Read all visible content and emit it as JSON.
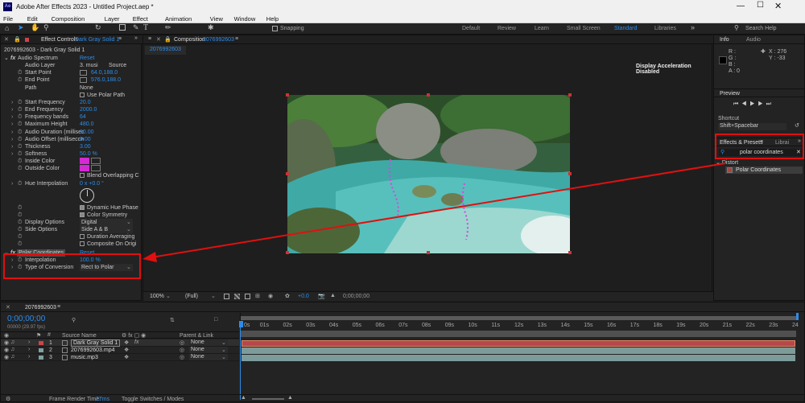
{
  "window": {
    "title": "Adobe After Effects 2023 - Untitled Project.aep *",
    "app_icon": "Ae"
  },
  "menu": [
    "File",
    "Edit",
    "Composition",
    "Layer",
    "Effect",
    "Animation",
    "View",
    "Window",
    "Help"
  ],
  "toolbar": {
    "snapping": "Snapping",
    "workspaces": [
      "Default",
      "Review",
      "Learn",
      "Small Screen",
      "Standard",
      "Libraries"
    ],
    "active_workspace": "Standard",
    "search_placeholder": "Search Help"
  },
  "effect_controls": {
    "tab_label": "Effect Controls",
    "layer_name": "Dark Gray Solid 1",
    "comp_layer": "2076992603 - Dark Gray Solid 1",
    "effects": [
      {
        "name": "Audio Spectrum",
        "reset": "Reset"
      },
      {
        "name": "Polar Coordinates",
        "reset": "Reset"
      }
    ],
    "audio_spectrum_props": [
      {
        "label": "Audio Layer",
        "value": "3. musi",
        "value2": "Source"
      },
      {
        "label": "Start Point",
        "value": "64.0,188.0"
      },
      {
        "label": "End Point",
        "value": "576.0,188.0"
      },
      {
        "label": "Path",
        "value": "None"
      },
      {
        "label": "",
        "value": "Use Polar Path"
      },
      {
        "label": "Start Frequency",
        "value": "20.0"
      },
      {
        "label": "End Frequency",
        "value": "2000.0"
      },
      {
        "label": "Frequency bands",
        "value": "64"
      },
      {
        "label": "Maximum Height",
        "value": "480.0"
      },
      {
        "label": "Audio Duration (millisec",
        "value": "90.00"
      },
      {
        "label": "Audio Offset (millisecon",
        "value": "0.00"
      },
      {
        "label": "Thickness",
        "value": "3.00"
      },
      {
        "label": "Softness",
        "value": "50.0 %"
      },
      {
        "label": "Inside Color",
        "value": ""
      },
      {
        "label": "Outside Color",
        "value": ""
      },
      {
        "label": "",
        "value": "Blend Overlapping C"
      },
      {
        "label": "Hue Interpolation",
        "value": "0 x +0.0 °"
      }
    ],
    "audio_spectrum_props2": [
      {
        "label": "",
        "value": "Dynamic Hue Phase"
      },
      {
        "label": "",
        "value": "Color Symmetry"
      },
      {
        "label": "Display Options",
        "value": "Digital"
      },
      {
        "label": "Side Options",
        "value": "Side A & B"
      },
      {
        "label": "",
        "value": "Duration Averaging"
      },
      {
        "label": "",
        "value": "Composite On Origi"
      }
    ],
    "polar_props": [
      {
        "label": "Interpolation",
        "value": "100.0 %"
      },
      {
        "label": "Type of Conversion",
        "value": "Rect to Polar"
      }
    ]
  },
  "composition": {
    "tab_label": "Composition",
    "comp_name": "2076992603",
    "breadcrumb": "2076992603",
    "notice": "Display Acceleration Disabled",
    "zoom": "100%",
    "resolution": "(Full)",
    "exposure": "+0.0",
    "timecode": "0;00;00;00"
  },
  "info": {
    "tabs": [
      "Info",
      "Audio"
    ],
    "r": "R :",
    "g": "G :",
    "b": "B :",
    "a": "A :",
    "a_val": "0",
    "x": "X : 276",
    "y": "Y : -33"
  },
  "preview": {
    "title": "Preview",
    "shortcut_label": "Shortcut",
    "shortcut_value": "Shift+Spacebar"
  },
  "effects_presets": {
    "tabs": [
      "Effects & Presets",
      "Librai"
    ],
    "search_value": "polar coordinates",
    "category": "Distort",
    "result": "Polar Coordinates"
  },
  "timeline": {
    "comp_tab": "2076992603",
    "timecode": "0;00;00;00",
    "fps": "00000 (29.97 fps)",
    "col_source": "Source Name",
    "col_parent": "Parent & Link",
    "ticks": [
      "0s",
      "01s",
      "02s",
      "03s",
      "04s",
      "05s",
      "06s",
      "07s",
      "08s",
      "09s",
      "10s",
      "11s",
      "12s",
      "13s",
      "14s",
      "15s",
      "16s",
      "17s",
      "18s",
      "19s",
      "20s",
      "21s",
      "22s",
      "23s",
      "24"
    ],
    "layers": [
      {
        "num": "1",
        "name": "Dark Gray Solid 1",
        "parent": "None",
        "color": "#c9464a"
      },
      {
        "num": "2",
        "name": "2076992603.mp4",
        "parent": "None",
        "color": "#7fa0a0"
      },
      {
        "num": "3",
        "name": "music.mp3",
        "parent": "None",
        "color": "#7fa0a0"
      }
    ],
    "footer_label": "Frame Render Time:",
    "footer_value": "27ms",
    "toggle": "Toggle Switches / Modes"
  },
  "colors": {
    "accent": "#2d8ceb",
    "highlight": "#e01010",
    "magenta": "#d42ad4"
  }
}
